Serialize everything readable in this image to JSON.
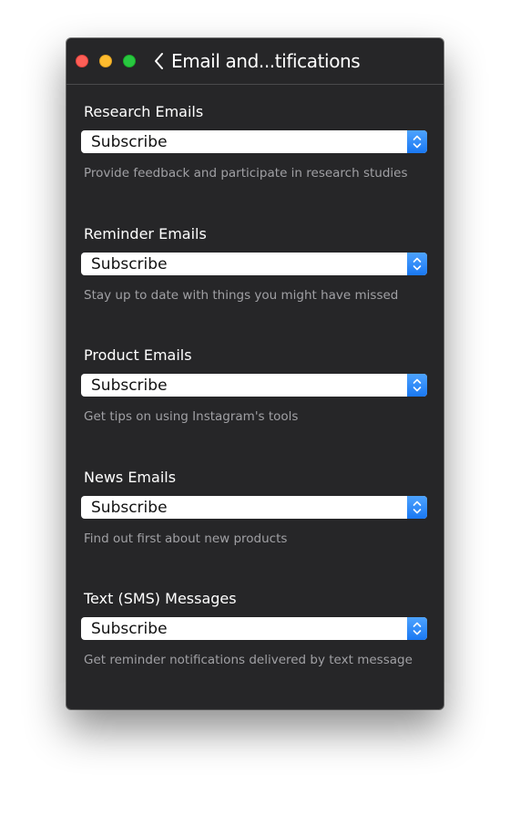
{
  "window": {
    "title": "Email and...tifications"
  },
  "sections": [
    {
      "title": "Research Emails",
      "selected": "Subscribe",
      "description": "Provide feedback and participate in research studies"
    },
    {
      "title": "Reminder Emails",
      "selected": "Subscribe",
      "description": "Stay up to date with things you might have missed"
    },
    {
      "title": "Product Emails",
      "selected": "Subscribe",
      "description": "Get tips on using Instagram's tools"
    },
    {
      "title": "News Emails",
      "selected": "Subscribe",
      "description": "Find out first about new products"
    },
    {
      "title": "Text (SMS) Messages",
      "selected": "Subscribe",
      "description": "Get reminder notifications delivered by text message"
    }
  ],
  "icons": {
    "back": "chevron-left-icon",
    "select": "up-down-chevron-icon"
  },
  "colors": {
    "window_bg": "#262628",
    "accent": "#1a78f2",
    "close": "#fe5f57",
    "minimize": "#febc2e",
    "zoom": "#28c840"
  }
}
